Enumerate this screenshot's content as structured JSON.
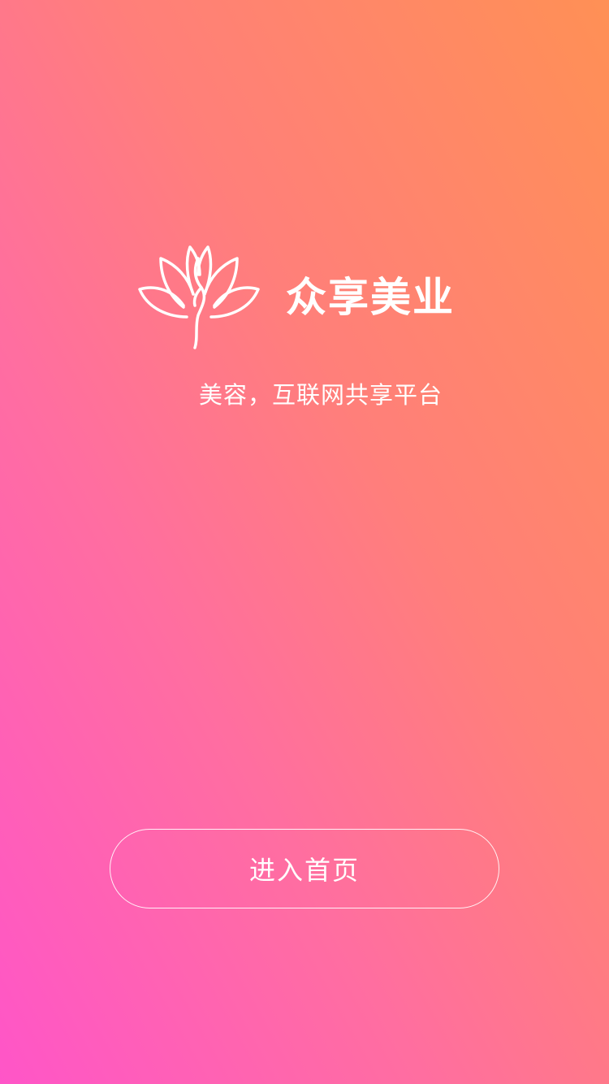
{
  "brand": {
    "logo_icon": "lotus-icon",
    "name": "众享美业",
    "tagline": "美容，互联网共享平台"
  },
  "actions": {
    "enter_label": "进入首页"
  },
  "colors": {
    "gradient_start": "#ff55c8",
    "gradient_end": "#ff9055",
    "text": "#ffffff"
  }
}
